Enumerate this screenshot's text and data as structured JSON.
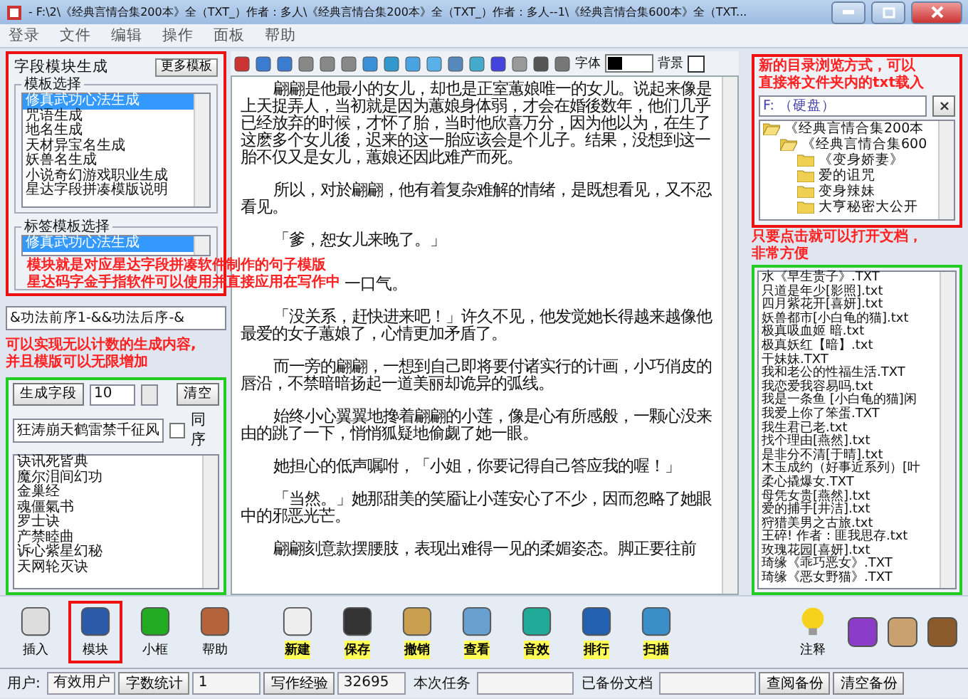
{
  "window": {
    "title": "- F:\\2\\《经典言情合集200本》全（TXT_）作者：多人\\《经典言情合集200本》全（TXT_）作者：多人--1\\《经典言情合集600本》全（TXT..."
  },
  "menu": [
    "登录",
    "文件",
    "编辑",
    "操作",
    "面板",
    "帮助"
  ],
  "left_panel": {
    "title": "字段模块生成",
    "more_button": "更多模板",
    "template_group": {
      "title": "模板选择",
      "items": [
        {
          "label": "修真武功心法生成",
          "selected": true
        },
        {
          "label": "咒语生成",
          "selected": false
        },
        {
          "label": "地名生成",
          "selected": false
        },
        {
          "label": "天材异宝名生成",
          "selected": false
        },
        {
          "label": "妖兽名生成",
          "selected": false
        },
        {
          "label": "小说奇幻游戏职业生成",
          "selected": false
        },
        {
          "label": "星达字段拼凑模版说明",
          "selected": false
        }
      ]
    },
    "tag_group": {
      "title": "标签模板选择",
      "items": [
        {
          "label": "修真武功心法生成",
          "selected": true
        }
      ]
    },
    "pattern_text": "&功法前序1-&&功法后序-&",
    "generate_button": "生成字段",
    "count": "10",
    "clear_button": "清空",
    "name_field": "狂涛崩天鹤雷禁千征风",
    "same_order": {
      "label": "同序",
      "checked": false
    },
    "results": [
      "诀讯死皆典",
      "魔尔泪间幻功",
      "金巢经",
      "魂僵氣书",
      "罗士诀",
      "产禁睦曲",
      "诉心紫星幻秘",
      "天网轮灭诀"
    ]
  },
  "editor": {
    "font_label": "字体",
    "background_label": "背景",
    "paragraphs": [
      {
        "kind": "normal",
        "text": "翩翩是他最小的女儿，却也是正室蕙娘唯一的女儿。说起来像是上天捉弄人，当初就是因为蕙娘身体弱，才会在婚後数年，他们几乎已经放弃的时候，才怀了胎，当时他欣喜万分，因为他以为，在生了这麽多个女儿後，迟来的这一胎应该会是个儿子。结果，没想到这一胎不仅又是女儿，蕙娘还因此难产而死。"
      },
      {
        "kind": "normal",
        "text": "所以，对於翩翩，他有着复杂难解的情绪，是既想看见，又不忍看见。"
      },
      {
        "kind": "normal",
        "text": "「爹，恕女儿来晚了。」"
      },
      {
        "kind": "covered",
        "text": "一口气。"
      },
      {
        "kind": "normal",
        "text": "「没关系，赶快进来吧！」许久不见，他发觉她长得越来越像他最爱的女子蕙娘了，心情更加矛盾了。"
      },
      {
        "kind": "normal",
        "text": "而一旁的翩翩，一想到自己即将要付诸实行的计画，小巧俏皮的唇沿，不禁暗暗扬起一道美丽却诡异的弧线。"
      },
      {
        "kind": "normal",
        "text": "始终小心翼翼地搀着翩翩的小莲，像是心有所感般，一颗心没来由的跳了一下，悄悄狐疑地偷觑了她一眼。"
      },
      {
        "kind": "normal",
        "text": "她担心的低声嘱咐，「小姐，你要记得自己答应我的喔！」"
      },
      {
        "kind": "normal",
        "text": "「当然。」她那甜美的笑靥让小莲安心了不少，因而忽略了她眼中的邪恶光芒。"
      },
      {
        "kind": "normal",
        "text": "翩翩刻意款摆腰肢，表现出难得一见的柔媚姿态。脚正要往前"
      }
    ]
  },
  "browser": {
    "drive": "F: （硬盘）",
    "tree": [
      {
        "label": "《经典言情合集200本",
        "expanded": true,
        "children": [
          {
            "label": "《经典言情合集600",
            "expanded": true,
            "children": [
              {
                "label": "《变身娇妻》",
                "expanded": false
              },
              {
                "label": "爱的诅咒",
                "expanded": false
              },
              {
                "label": "变身辣妹",
                "expanded": false
              },
              {
                "label": "大亨秘密大公开",
                "expanded": false
              }
            ]
          }
        ]
      }
    ],
    "files": [
      "水《早生贵子》.TXT",
      "只道是年少[影照].txt",
      "四月紫花开[喜妍].txt",
      "妖兽都市[小白龟的猫].txt",
      "极真吸血姬 暗.txt",
      "极真妖红【暗】.txt",
      "干妹妹.TXT",
      "我和老公的性福生活.TXT",
      "我恋爱我容易吗.txt",
      "我是一条鱼 [小白龟的猫]闲",
      "我爱上你了笨蛋.TXT",
      "我生君已老.txt",
      "找个理由[燕然].txt",
      "是非分不清[于晴].txt",
      "木玉成约（好事近系列）[叶",
      "柔心撬爆女.TXT",
      "母凭女贵[燕然].txt",
      "爱的捕手[井洁].txt",
      "狩猎美男之古旅.txt",
      "王碎! 作者：匪我思存.txt",
      "玫瑰花园[喜妍].txt",
      "琦缘《乖巧恶女》.TXT",
      "琦缘《恶女野猫》.TXT"
    ]
  },
  "toolbar": {
    "left": [
      {
        "label": "插入",
        "selected": false
      },
      {
        "label": "模块",
        "selected": true
      },
      {
        "label": "小框",
        "selected": false
      },
      {
        "label": "帮助",
        "selected": false
      }
    ],
    "center": [
      "新建",
      "保存",
      "撤销",
      "查看",
      "音效",
      "排行",
      "扫描"
    ],
    "right": [
      "注释"
    ]
  },
  "status_bar": [
    {
      "kind": "label",
      "text": "用户:"
    },
    {
      "kind": "value",
      "text": "有效用户"
    },
    {
      "kind": "button",
      "text": "字数统计"
    },
    {
      "kind": "value",
      "text": "1"
    },
    {
      "kind": "button",
      "text": "写作经验"
    },
    {
      "kind": "value",
      "text": "32695"
    },
    {
      "kind": "label",
      "text": "本次任务"
    },
    {
      "kind": "value"
    },
    {
      "kind": "label",
      "text": "已备份文档"
    },
    {
      "kind": "value"
    },
    {
      "kind": "button",
      "text": "查阅备份"
    },
    {
      "kind": "button",
      "text": "清空备份"
    }
  ],
  "annotations": [
    {
      "lines": [
        "模块就是对应星达字段拼凑软件制作的句子模版",
        "星达码字金手指软件可以使用并直接应用在写作中"
      ]
    },
    {
      "lines": [
        "可以实现无以计数的生成内容,",
        "并且模版可以无限增加"
      ]
    },
    {
      "lines": [
        "新的目录浏览方式，可以",
        "直接将文件夹内的txt载入"
      ]
    },
    {
      "lines": [
        "只要点击就可以打开文档，",
        "非常方便"
      ]
    }
  ]
}
